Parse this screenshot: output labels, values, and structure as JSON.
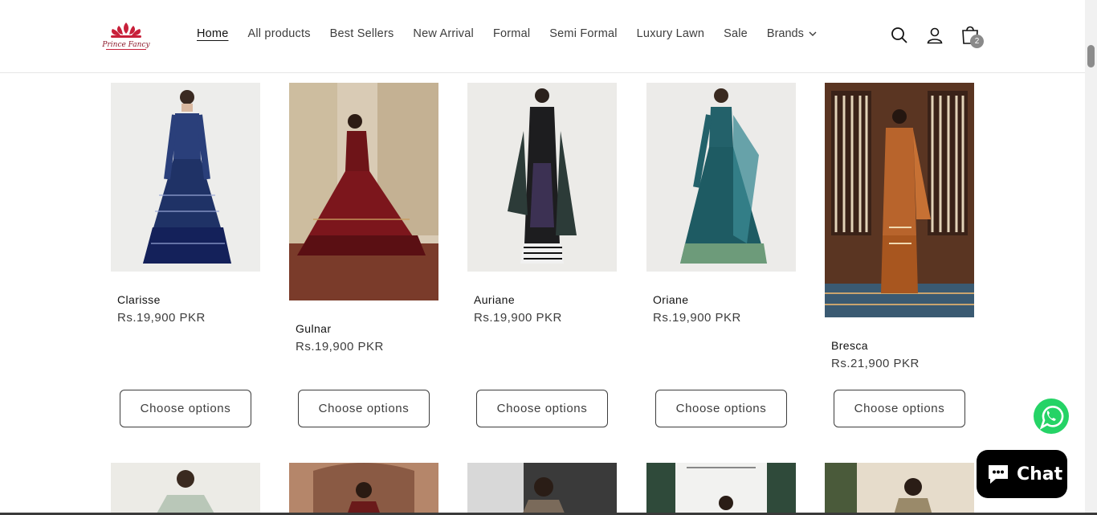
{
  "header": {
    "logo_text": "Prince Fancy",
    "nav": [
      "Home",
      "All products",
      "Best Sellers",
      "New Arrival",
      "Formal",
      "Semi Formal",
      "Luxury Lawn",
      "Sale"
    ],
    "brands_label": "Brands",
    "cart_count": "2"
  },
  "products": [
    {
      "name": "Clarisse",
      "price": "Rs.19,900 PKR",
      "button": "Choose options"
    },
    {
      "name": "Gulnar",
      "price": "Rs.19,900 PKR",
      "button": "Choose options"
    },
    {
      "name": "Auriane",
      "price": "Rs.19,900 PKR",
      "button": "Choose options"
    },
    {
      "name": "Oriane",
      "price": "Rs.19,900 PKR",
      "button": "Choose options"
    },
    {
      "name": "Bresca",
      "price": "Rs.21,900 PKR",
      "button": "Choose options"
    }
  ],
  "chat": {
    "label": "Chat"
  },
  "colors": {
    "accent": "#121212",
    "chat_bg": "#000000",
    "whatsapp": "#25D366"
  }
}
